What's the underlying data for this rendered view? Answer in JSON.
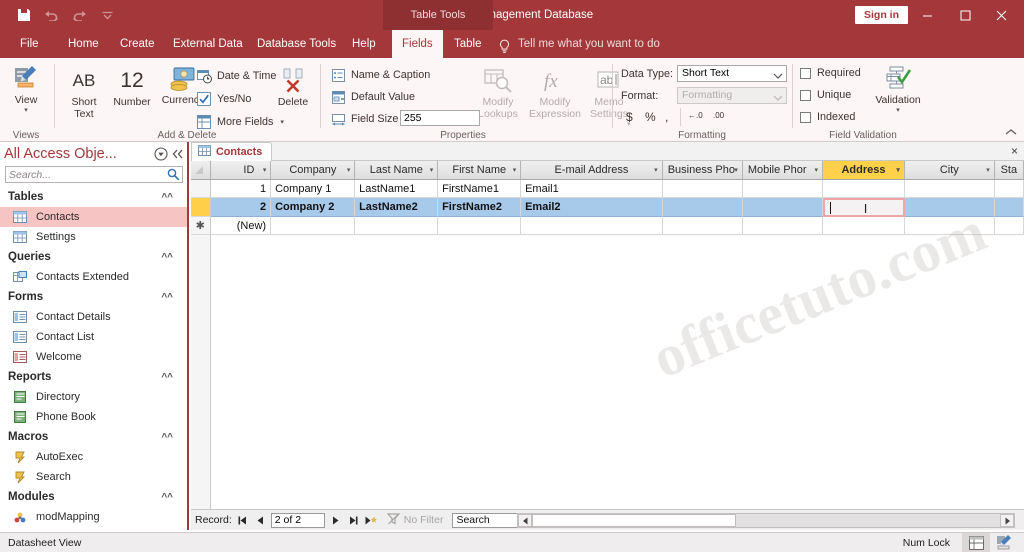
{
  "titlebar": {
    "document_title": "Contact Management Database",
    "context_tab_label": "Table Tools",
    "signin_label": "Sign in",
    "quick_access": [
      {
        "name": "save",
        "glyph": "save-icon"
      },
      {
        "name": "undo",
        "glyph": "undo-icon"
      },
      {
        "name": "redo",
        "glyph": "redo-icon"
      },
      {
        "name": "customize",
        "glyph": "chevron-down-icon"
      }
    ],
    "window_controls": {
      "minimize": "—",
      "maximize": "☐",
      "close": "✕"
    }
  },
  "ribbon_tabs": [
    {
      "label": "File",
      "active": false
    },
    {
      "label": "Home",
      "active": false
    },
    {
      "label": "Create",
      "active": false
    },
    {
      "label": "External Data",
      "active": false
    },
    {
      "label": "Database Tools",
      "active": false
    },
    {
      "label": "Help",
      "active": false
    },
    {
      "label": "Fields",
      "active": true
    },
    {
      "label": "Table",
      "active": false
    }
  ],
  "tell_me": {
    "label": "Tell me what you want to do",
    "icon": "lightbulb-icon"
  },
  "ribbon": {
    "groups": [
      {
        "name": "views",
        "label": "Views"
      },
      {
        "name": "add_delete",
        "label": "Add & Delete"
      },
      {
        "name": "properties",
        "label": "Properties"
      },
      {
        "name": "formatting",
        "label": "Formatting"
      },
      {
        "name": "field_validation",
        "label": "Field Validation"
      }
    ],
    "views": {
      "view_label": "View"
    },
    "add_delete": {
      "short_text": {
        "glyph": "AB",
        "line1": "Short",
        "line2": "Text"
      },
      "number": {
        "glyph": "12",
        "label": "Number"
      },
      "currency": {
        "label": "Currency"
      },
      "date_time": "Date & Time",
      "yes_no": "Yes/No",
      "more_fields": "More Fields",
      "delete": "Delete"
    },
    "properties": {
      "name_caption": "Name & Caption",
      "default_value": "Default Value",
      "field_size_label": "Field Size",
      "field_size_value": "255",
      "modify_lookups": {
        "line1": "Modify",
        "line2": "Lookups"
      },
      "modify_expression": {
        "line1": "Modify",
        "line2": "Expression"
      },
      "memo_settings": {
        "line1": "Memo",
        "line2": "Settings"
      }
    },
    "formatting": {
      "data_type_label": "Data Type:",
      "data_type_value": "Short Text",
      "format_label": "Format:",
      "format_value": "Formatting",
      "currency_symbol": "$",
      "percent_symbol": "%",
      "comma_symbol": ",",
      "decrease_decimal": "←.0",
      "increase_decimal": ".00"
    },
    "field_validation": {
      "required": "Required",
      "unique": "Unique",
      "indexed": "Indexed",
      "validation": "Validation"
    }
  },
  "nav_pane": {
    "title": "All Access Obje...",
    "search_placeholder": "Search...",
    "groups": [
      {
        "label": "Tables",
        "items": [
          {
            "label": "Contacts",
            "icon": "table-icon",
            "selected": true
          },
          {
            "label": "Settings",
            "icon": "table-icon",
            "selected": false
          }
        ]
      },
      {
        "label": "Queries",
        "items": [
          {
            "label": "Contacts Extended",
            "icon": "query-icon",
            "selected": false
          }
        ]
      },
      {
        "label": "Forms",
        "items": [
          {
            "label": "Contact Details",
            "icon": "form-icon",
            "selected": false
          },
          {
            "label": "Contact List",
            "icon": "form-icon",
            "selected": false
          },
          {
            "label": "Welcome",
            "icon": "form-icon",
            "selected": false
          }
        ]
      },
      {
        "label": "Reports",
        "items": [
          {
            "label": "Directory",
            "icon": "report-icon",
            "selected": false
          },
          {
            "label": "Phone Book",
            "icon": "report-icon",
            "selected": false
          }
        ]
      },
      {
        "label": "Macros",
        "items": [
          {
            "label": "AutoExec",
            "icon": "macro-icon",
            "selected": false
          },
          {
            "label": "Search",
            "icon": "macro-icon",
            "selected": false
          }
        ]
      },
      {
        "label": "Modules",
        "items": [
          {
            "label": "modMapping",
            "icon": "module-icon",
            "selected": false
          }
        ]
      }
    ]
  },
  "document": {
    "tab_label": "Contacts",
    "tab_icon": "table-icon",
    "close_glyph": "×"
  },
  "datasheet": {
    "columns": [
      {
        "label": "ID",
        "width": 62,
        "align": "right",
        "active": false
      },
      {
        "label": "Company",
        "width": 86,
        "align": "left",
        "active": false
      },
      {
        "label": "Last Name",
        "width": 85,
        "align": "left",
        "active": false
      },
      {
        "label": "First Name",
        "width": 85,
        "align": "left",
        "active": false
      },
      {
        "label": "E-mail Address",
        "width": 145,
        "align": "left",
        "active": false
      },
      {
        "label": "Business Pho",
        "width": 82,
        "align": "left",
        "active": false
      },
      {
        "label": "Mobile Phor",
        "width": 82,
        "align": "left",
        "active": false
      },
      {
        "label": "Address",
        "width": 84,
        "align": "left",
        "active": true
      },
      {
        "label": "City",
        "width": 92,
        "align": "left",
        "active": false
      },
      {
        "label": "Sta",
        "width": 30,
        "align": "left",
        "active": false
      }
    ],
    "rows": [
      {
        "selector": "",
        "selected": false,
        "cells": [
          "1",
          "Company 1",
          "LastName1",
          "FirstName1",
          "Email1",
          "",
          "",
          "",
          "",
          ""
        ]
      },
      {
        "selector": "",
        "selected": true,
        "editing_column_index": 7,
        "cells": [
          "2",
          "Company 2",
          "LastName2",
          "FirstName2",
          "Email2",
          "",
          "",
          "",
          "",
          ""
        ]
      },
      {
        "selector": "✱",
        "selected": false,
        "cells": [
          "(New)",
          "",
          "",
          "",
          "",
          "",
          "",
          "",
          "",
          ""
        ]
      }
    ]
  },
  "record_nav": {
    "label": "Record:",
    "first": "⏮",
    "previous": "◀",
    "value": "2 of 2",
    "next": "▶",
    "last": "⏭",
    "new_record": "▶✱",
    "filter_label": "No Filter",
    "filter_icon": "filter-icon",
    "search_value": "Search"
  },
  "status_bar": {
    "view_label": "Datasheet View",
    "num_lock": "Num Lock",
    "view_buttons": [
      {
        "name": "datasheet-view",
        "active": true
      },
      {
        "name": "design-view",
        "active": false
      }
    ]
  },
  "watermark": {
    "text": "officetuto.com"
  }
}
